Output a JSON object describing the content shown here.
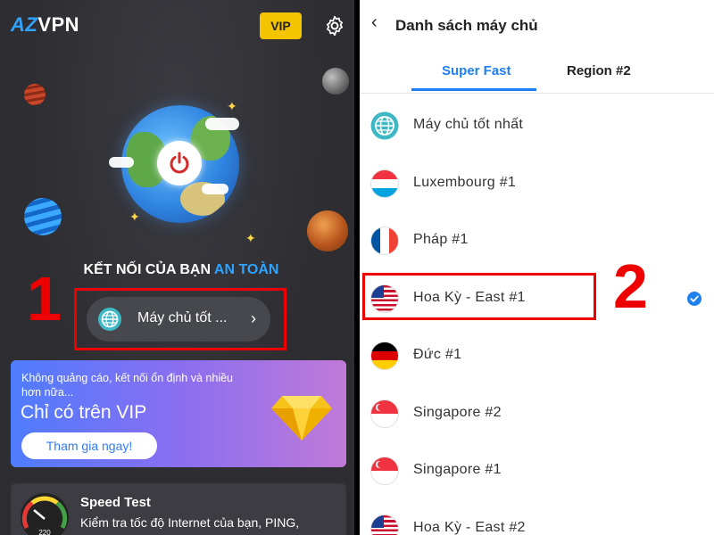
{
  "left": {
    "app_name_prefix": "AZ",
    "app_name_suffix": "VPN",
    "vip_label": "VIP",
    "connection_status_prefix": "KẾT NỐI CỦA BẠN",
    "connection_status_value": "AN TOÀN",
    "step_number": "1",
    "current_server": "Máy chủ tốt ...",
    "promo": {
      "description": "Không quảng cáo, kết nối ổn định và nhiều hơn nữa...",
      "title": "Chỉ có trên VIP",
      "button": "Tham gia ngay!"
    },
    "speed_test": {
      "title": "Speed Test",
      "description": "Kiểm tra tốc độ Internet của bạn, PING,",
      "gauge_label": "220"
    }
  },
  "right": {
    "title": "Danh sách máy chủ",
    "tabs": [
      {
        "label": "Super Fast",
        "active": true
      },
      {
        "label": "Region #2",
        "active": false
      }
    ],
    "step_number": "2",
    "servers": [
      {
        "name": "Máy chủ tốt nhất",
        "flag": "globe-icon",
        "selected": false
      },
      {
        "name": "Luxembourg #1",
        "flag": "luxembourg-flag",
        "selected": false
      },
      {
        "name": "Pháp #1",
        "flag": "france-flag",
        "selected": false
      },
      {
        "name": "Hoa Kỳ - East #1",
        "flag": "usa-flag",
        "selected": true
      },
      {
        "name": "Đức #1",
        "flag": "germany-flag",
        "selected": false
      },
      {
        "name": "Singapore #2",
        "flag": "singapore-flag",
        "selected": false
      },
      {
        "name": "Singapore #1",
        "flag": "singapore-flag",
        "selected": false
      },
      {
        "name": "Hoa Kỳ - East #2",
        "flag": "usa-flag",
        "selected": false
      }
    ]
  },
  "colors": {
    "accent": "#1f7ff0",
    "annotation": "#e00000",
    "vip": "#f5c400",
    "dark_bg": "#2e2e32"
  }
}
